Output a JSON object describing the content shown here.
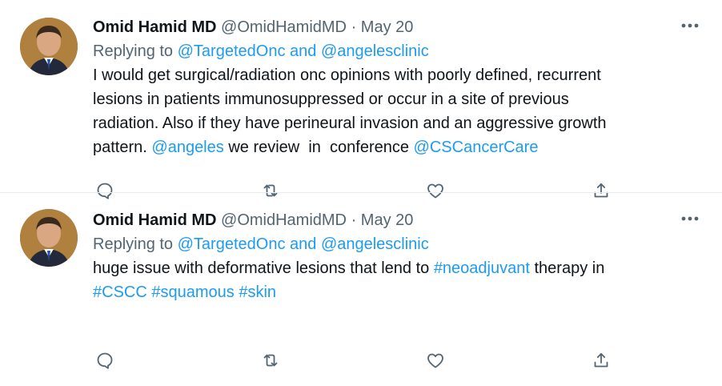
{
  "tweets": [
    {
      "author_name": "Omid Hamid MD",
      "handle": "@OmidHamidMD",
      "separator": "·",
      "date": "May 20",
      "replying_prefix": "Replying to ",
      "replying_user1": "@TargetedOnc",
      "replying_and": " and ",
      "replying_user2": "@angelesclinic",
      "body_part1": "I would get surgical/radiation onc opinions with poorly defined, recurrent\nlesions in patients immunosuppressed or occur in a site of previous\nradiation. Also if they have perineural invasion and an aggressive growth\npattern. ",
      "mention1": "@angeles",
      "body_part2": " we review  in  conference ",
      "mention2": "@CSCancerCare"
    },
    {
      "author_name": "Omid Hamid MD",
      "handle": "@OmidHamidMD",
      "separator": "·",
      "date": "May 20",
      "replying_prefix": "Replying to ",
      "replying_user1": "@TargetedOnc",
      "replying_and": " and ",
      "replying_user2": "@angelesclinic",
      "body_part1": "huge issue with deformative lesions that lend to ",
      "hashtag1": "#neoadjuvant",
      "body_part2": " therapy in\n",
      "hashtag2": "#CSCC",
      "hashtag3": "#squamous",
      "hashtag4": "#skin"
    }
  ],
  "colors": {
    "link": "#1d9bf0",
    "secondary_text": "#536471",
    "primary_text": "#0f1419",
    "divider": "#e6ecf0"
  },
  "icons": [
    "more-icon",
    "reply-icon",
    "retweet-icon",
    "like-icon",
    "share-icon"
  ]
}
